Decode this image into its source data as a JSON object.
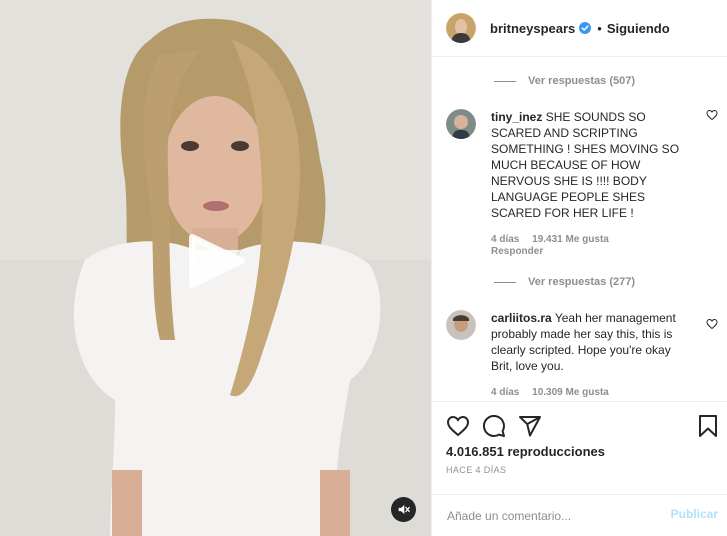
{
  "post": {
    "username": "britneyspears",
    "separator": "•",
    "follow_state": "Siguiendo"
  },
  "comments": {
    "replies_top": "Ver respuestas (507)",
    "items": [
      {
        "user": "tiny_inez",
        "text": "SHE SOUNDS SO SCARED AND SCRIPTING SOMETHING ! SHES MOVING SO MUCH BECAUSE OF HOW NERVOUS SHE IS !!!! BODY LANGUAGE PEOPLE SHES SCARED FOR HER LIFE !",
        "time": "4 días",
        "likes": "19.431 Me gusta",
        "reply": "Responder",
        "replies": "Ver respuestas (277)"
      },
      {
        "user": "carliitos.ra",
        "text": "Yeah her management probably made her say this, this is clearly scripted. Hope you're okay Brit, love you.",
        "time": "4 días",
        "likes": "10.309 Me gusta"
      }
    ]
  },
  "actions": {
    "views": "4.016.851 reproducciones",
    "timeago": "HACE 4 DÍAS"
  },
  "add_comment": {
    "placeholder": "Añade un comentario...",
    "publish": "Publicar"
  },
  "icons": {
    "play": "play-icon",
    "mute": "muted-speaker-icon",
    "verified": "verified-badge-icon",
    "like": "heart-icon",
    "comment": "comment-bubble-icon",
    "share": "paper-plane-icon",
    "save": "bookmark-icon"
  },
  "colors": {
    "verified": "#3897f0",
    "publish_disabled": "#b2dffc",
    "secondary_text": "#8e8e8e"
  }
}
